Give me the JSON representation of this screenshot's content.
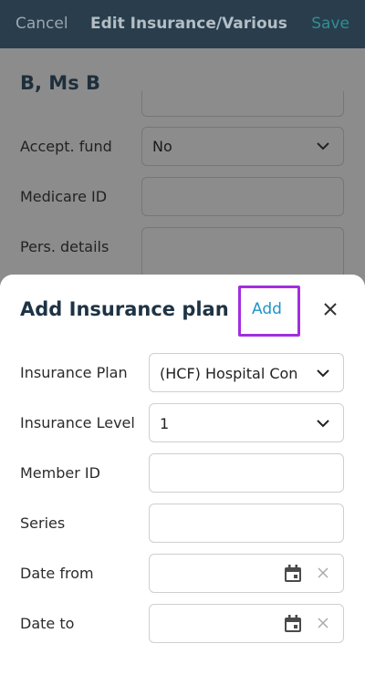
{
  "appbar": {
    "cancel_label": "Cancel",
    "title": "Edit Insurance/Various",
    "save_label": "Save"
  },
  "background_form": {
    "patient_name": "B, Ms B",
    "fields": [
      {
        "label": "Accept. fund",
        "value": "No"
      },
      {
        "label": "Medicare ID",
        "value": ""
      },
      {
        "label": "Pers. details",
        "value": ""
      }
    ]
  },
  "sheet": {
    "title": "Add Insurance plan",
    "add_label": "Add",
    "fields": [
      {
        "label": "Insurance Plan",
        "value": "(HCF) Hospital Con"
      },
      {
        "label": "Insurance Level",
        "value": "1"
      },
      {
        "label": "Member ID",
        "value": ""
      },
      {
        "label": "Series",
        "value": ""
      },
      {
        "label": "Date from",
        "value": ""
      },
      {
        "label": "Date to",
        "value": ""
      }
    ]
  },
  "colors": {
    "appbar": "#2a3d4c",
    "accent_link": "#1e95c8",
    "highlight": "#a12ee0"
  },
  "icons": [
    "chevron-down-icon",
    "close-icon",
    "calendar-icon",
    "clear-icon"
  ]
}
